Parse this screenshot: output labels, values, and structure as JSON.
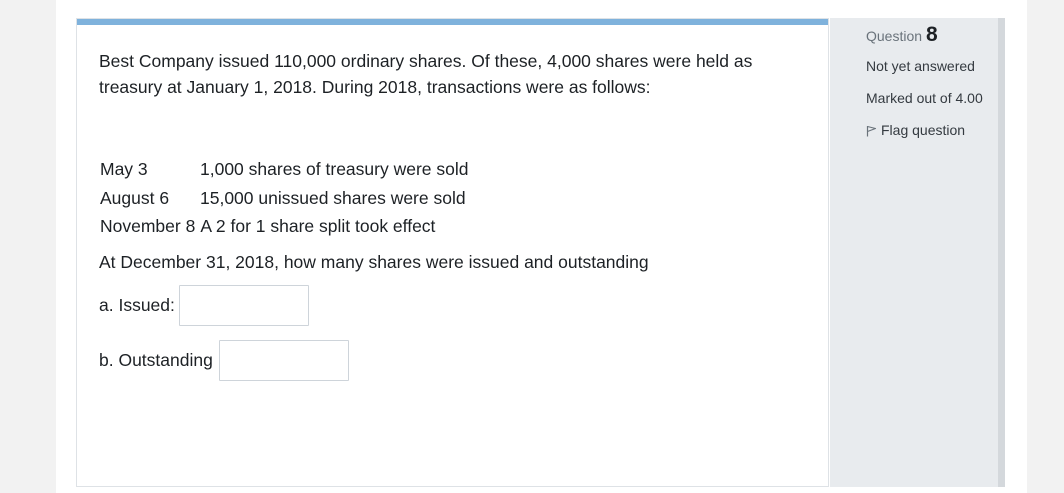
{
  "question": {
    "intro": "Best Company issued 110,000 ordinary shares. Of these, 4,000 shares were held as treasury at January 1, 2018. During 2018, transactions were as follows:",
    "transactions": [
      {
        "date": "May 3",
        "text": "1,000 shares of treasury were sold"
      },
      {
        "date": "August 6",
        "text": "15,000 unissued shares were sold"
      },
      {
        "date": "November 8",
        "text": "A 2 for 1 share split took effect"
      }
    ],
    "prompt": "At December 31, 2018, how many shares were issued and outstanding",
    "answers": [
      {
        "label": "a. Issued:",
        "value": ""
      },
      {
        "label": "b. Outstanding",
        "value": ""
      }
    ]
  },
  "info": {
    "question_label": "Question",
    "question_number": "8",
    "status": "Not yet answered",
    "marks": "Marked out of 4.00",
    "flag_label": "Flag question",
    "flag_icon": "flag-icon"
  },
  "colors": {
    "accent_bar": "#7fb2dc",
    "info_panel_bg": "#e8ebee"
  }
}
